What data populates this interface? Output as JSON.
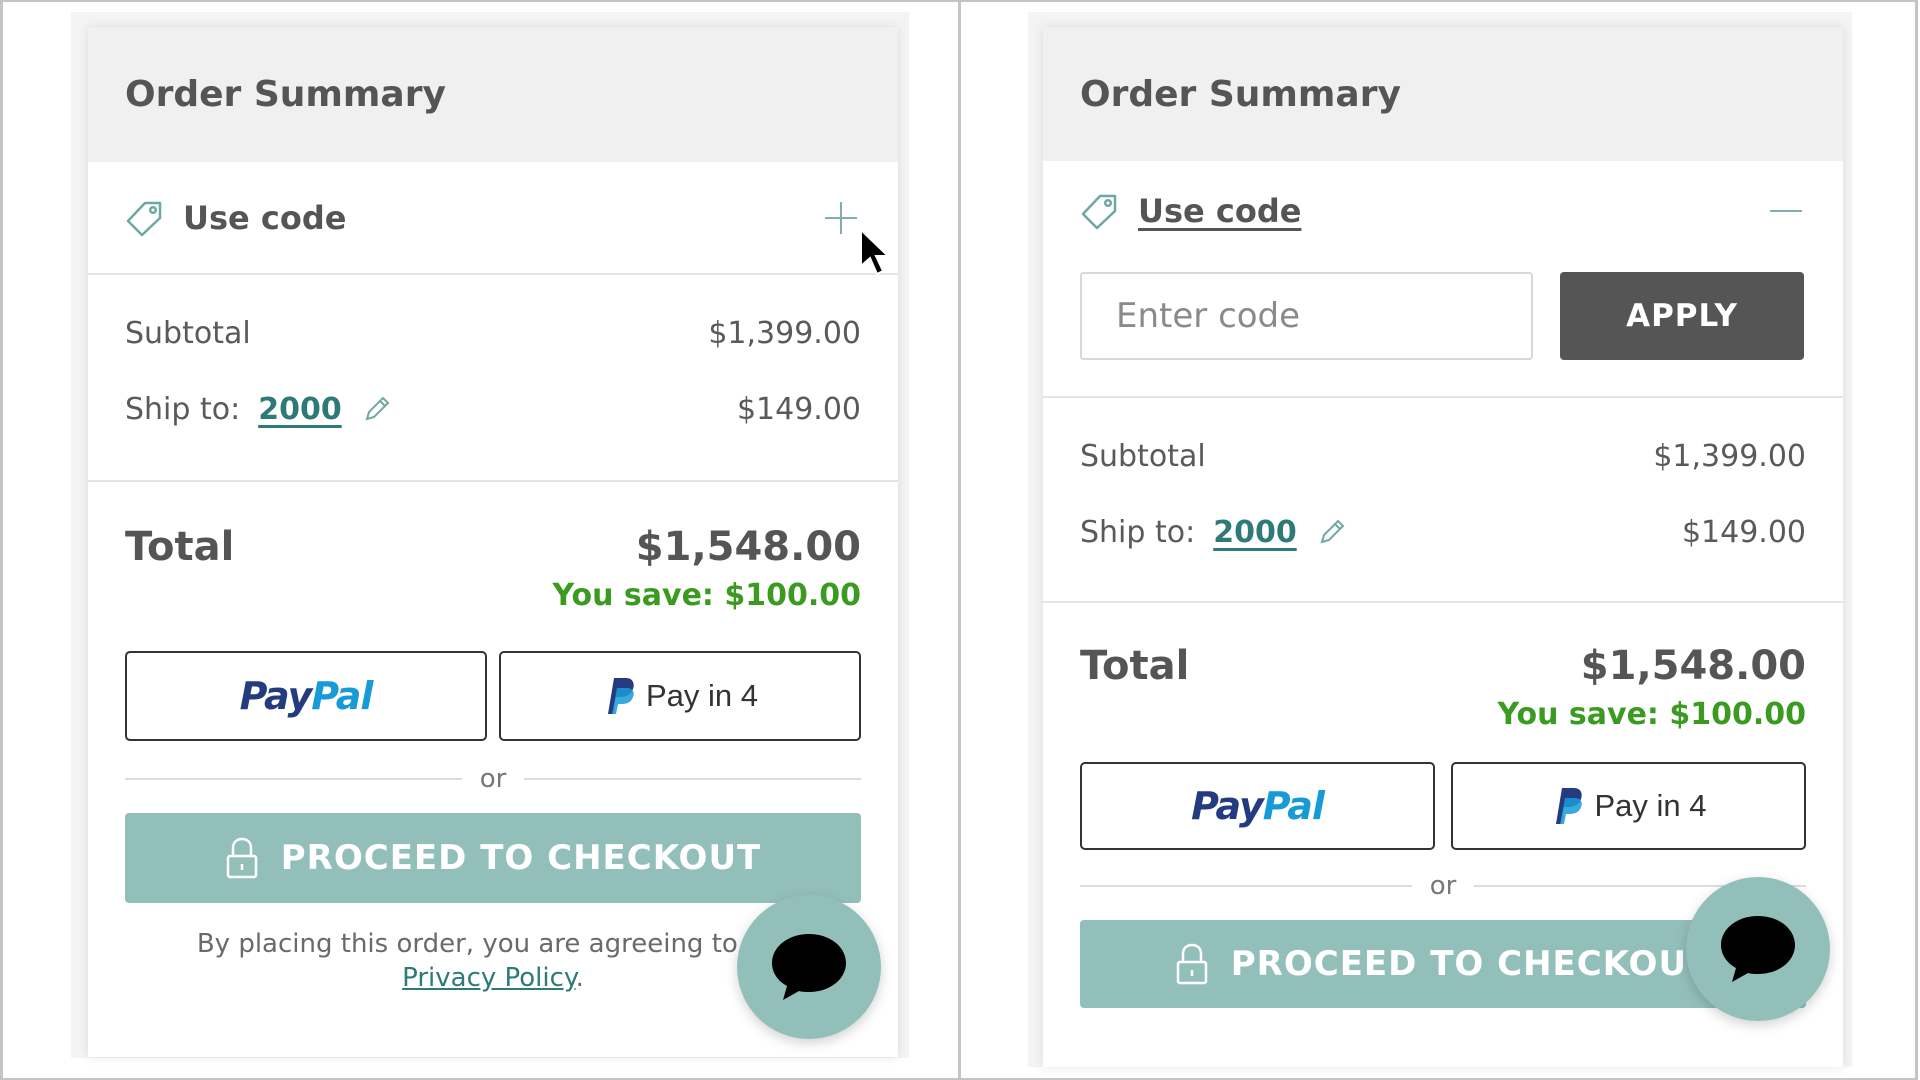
{
  "summary": {
    "title": "Order Summary",
    "use_code_label": "Use code",
    "code_placeholder": "Enter code",
    "apply_label": "APPLY",
    "subtotal_label": "Subtotal",
    "subtotal_value": "$1,399.00",
    "ship_label": "Ship to:",
    "ship_zip": "2000",
    "ship_value": "$149.00",
    "total_label": "Total",
    "total_value": "$1,548.00",
    "savings": "You save: $100.00",
    "paypal_pay": "Pay",
    "paypal_pal": "Pal",
    "pay_in_4": "Pay in 4",
    "or_label": "or",
    "checkout_label": "PROCEED TO CHECKOUT",
    "terms_text": "By placing this order, you are agreeing to our",
    "privacy_link": "Privacy Policy",
    "terms_end": "."
  },
  "icons": {
    "tag": "tag-icon",
    "expand": "plus-icon",
    "collapse": "minus-icon",
    "edit": "pencil-icon",
    "paypal_mark": "paypal-p-icon",
    "lock": "lock-icon",
    "chat": "chat-bubble-icon",
    "cursor": "mouse-cursor-icon"
  },
  "colors": {
    "accent_teal": "#93bfbb",
    "link_teal": "#2e7a76",
    "savings_green": "#3a9b20",
    "apply_bg": "#555555",
    "paypal_dark": "#253b80",
    "paypal_light": "#179bd7"
  }
}
